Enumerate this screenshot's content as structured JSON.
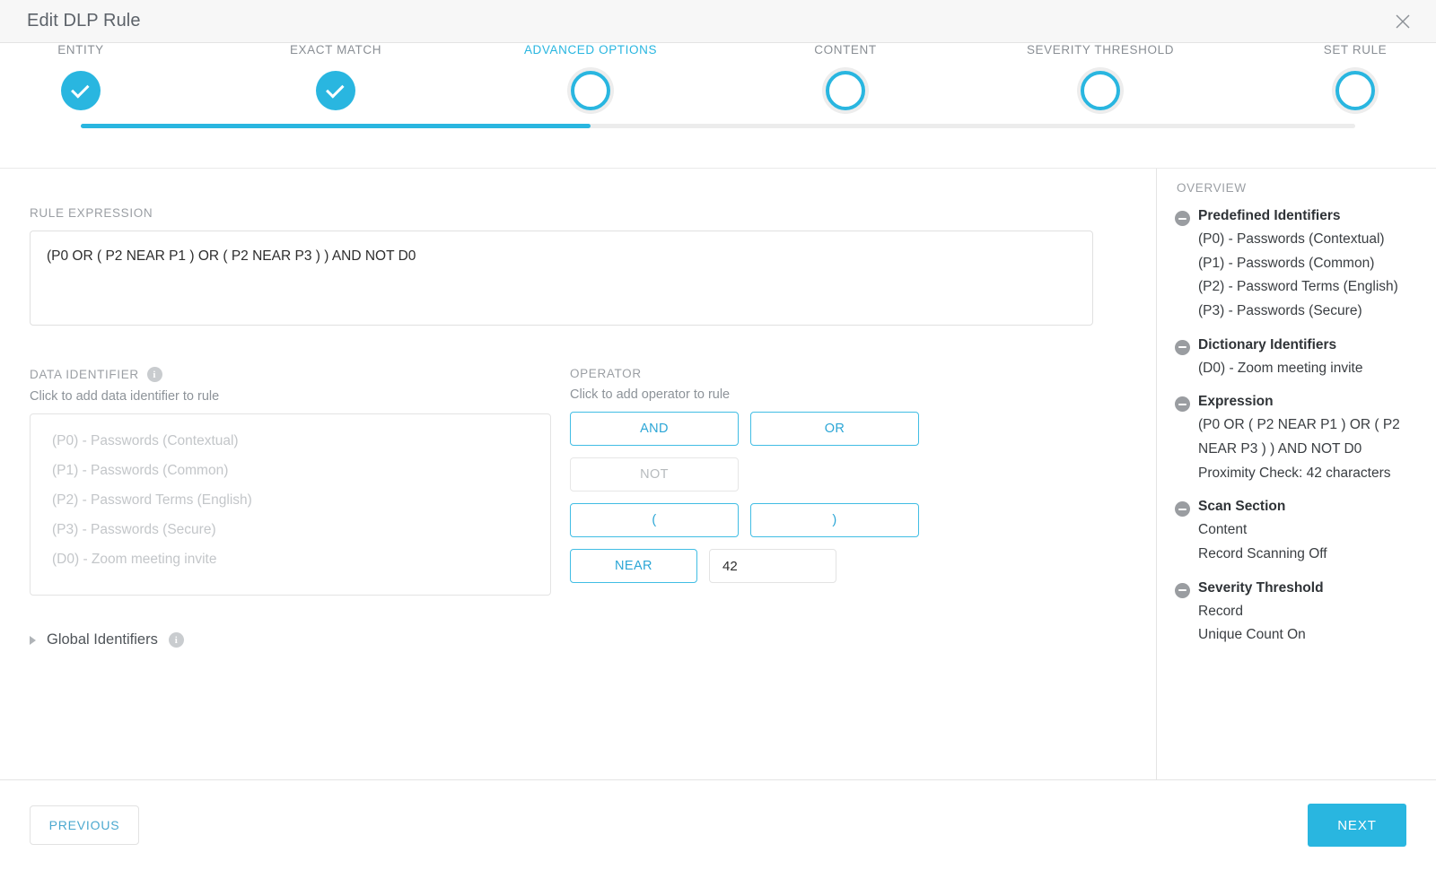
{
  "header": {
    "title": "Edit DLP Rule",
    "close_icon": "close-icon"
  },
  "stepper": {
    "steps": [
      {
        "label": "ENTITY",
        "state": "done"
      },
      {
        "label": "EXACT MATCH",
        "state": "done"
      },
      {
        "label": "ADVANCED OPTIONS",
        "state": "current"
      },
      {
        "label": "CONTENT",
        "state": "pending"
      },
      {
        "label": "SEVERITY THRESHOLD",
        "state": "pending"
      },
      {
        "label": "SET RULE",
        "state": "pending"
      }
    ],
    "active_color": "#29b6e0",
    "inactive_color": "#ececec"
  },
  "rule_expression": {
    "label": "RULE EXPRESSION",
    "value": "(P0 OR ( P2 NEAR P1 ) OR ( P2 NEAR P3 ) ) AND NOT D0"
  },
  "data_identifier": {
    "label": "DATA IDENTIFIER",
    "info_icon": "info-icon",
    "hint": "Click to add data identifier to rule",
    "items": [
      "(P0) - Passwords (Contextual)",
      "(P1) - Passwords (Common)",
      "(P2) - Password Terms (English)",
      "(P3) - Passwords (Secure)",
      "(D0) - Zoom meeting invite"
    ]
  },
  "operator": {
    "label": "OPERATOR",
    "hint": "Click to add operator to rule",
    "buttons": [
      {
        "label": "AND",
        "enabled": true
      },
      {
        "label": "OR",
        "enabled": true
      },
      {
        "label": "NOT",
        "enabled": false
      },
      {
        "label": "(",
        "enabled": true
      },
      {
        "label": ")",
        "enabled": true
      },
      {
        "label": "NEAR",
        "enabled": true
      }
    ],
    "near_value": "42"
  },
  "global_identifiers": {
    "label": "Global Identifiers",
    "expand_icon": "chevron-right-icon",
    "info_icon": "info-icon"
  },
  "overview": {
    "title": "OVERVIEW",
    "sections": [
      {
        "heading": "Predefined Identifiers",
        "lines": [
          "(P0) - Passwords (Contextual)",
          "(P1) - Passwords (Common)",
          "(P2) - Password Terms (English)",
          "(P3) - Passwords (Secure)"
        ]
      },
      {
        "heading": "Dictionary Identifiers",
        "lines": [
          "(D0) - Zoom meeting invite"
        ]
      },
      {
        "heading": "Expression",
        "lines": [
          "(P0 OR ( P2 NEAR P1 ) OR ( P2 NEAR P3 ) ) AND NOT D0",
          "Proximity Check: 42 characters"
        ]
      },
      {
        "heading": "Scan Section",
        "lines": [
          "Content",
          "Record Scanning Off"
        ]
      },
      {
        "heading": "Severity Threshold",
        "lines": [
          "Record",
          "Unique Count On"
        ]
      }
    ]
  },
  "footer": {
    "previous_label": "PREVIOUS",
    "next_label": "NEXT"
  }
}
